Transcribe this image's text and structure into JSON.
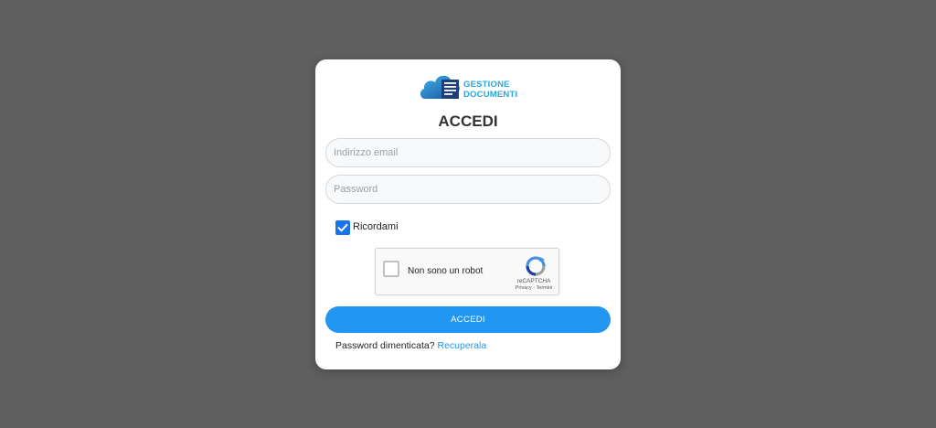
{
  "logo": {
    "line1": "GESTIONE",
    "line2": "DOCUMENTI",
    "icon": "cloud-document-icon"
  },
  "login": {
    "title": "ACCEDI",
    "email_placeholder": "Indirizzo email",
    "email_value": "",
    "password_placeholder": "Password",
    "password_value": "",
    "remember_label": "Ricordami",
    "remember_checked": true,
    "submit_label": "ACCEDI",
    "forgot_text": "Password dimenticata?",
    "recover_link": "Recuperala"
  },
  "recaptcha": {
    "label": "Non sono un robot",
    "brand": "reCAPTCHA",
    "links": "Privacy - Termini",
    "icon": "recaptcha-icon"
  },
  "colors": {
    "background": "#5f5f5f",
    "accent": "#2196f3",
    "checkbox": "#1a73e8",
    "logo_text": "#2aa5dd"
  }
}
